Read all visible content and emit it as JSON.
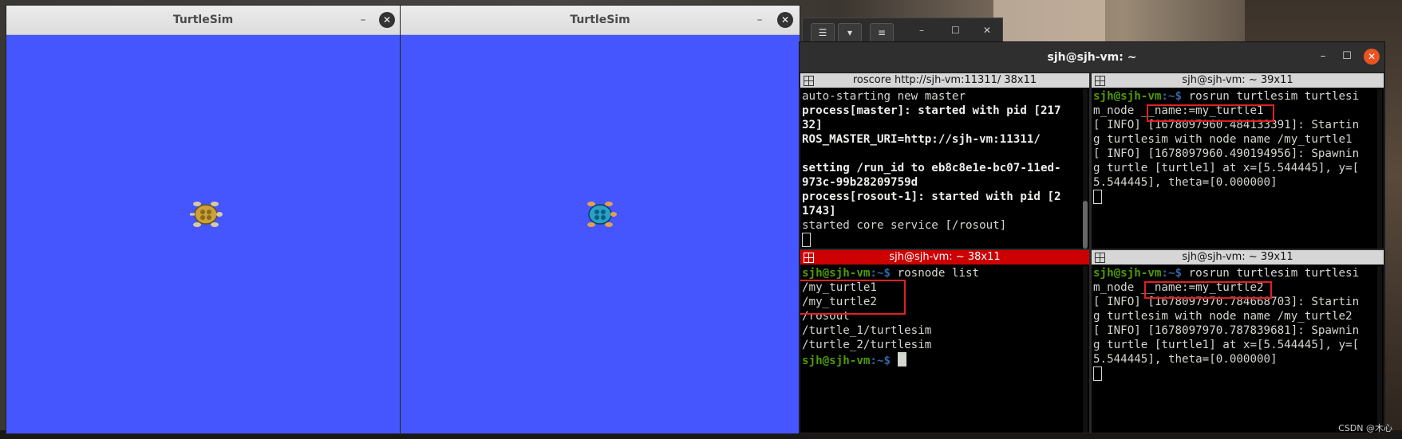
{
  "turtlesim1": {
    "title": "TurtleSim",
    "min": "–",
    "close": "✕"
  },
  "turtlesim2": {
    "title": "TurtleSim",
    "min": "–",
    "close": "✕"
  },
  "backwindow": {
    "btn1": "☰",
    "btn2": "▾",
    "btn3": "≡",
    "min": "–",
    "max": "☐",
    "close": "✕"
  },
  "terminal": {
    "title": "sjh@sjh-vm: ~",
    "min": "–",
    "max": "☐",
    "close": "✕",
    "panes": {
      "top_left": {
        "header": "roscore http://sjh-vm:11311/ 38x11",
        "lines": {
          "l1": "auto-starting new master",
          "l2a": "process[master]: started with pid [217",
          "l2b": "32]",
          "l3": "ROS_MASTER_URI=http://sjh-vm:11311/",
          "l4a": "setting /run_id to eb8c8e1e-bc07-11ed-",
          "l4b": "973c-99b28209759d",
          "l5a": "process[rosout-1]: started with pid [2",
          "l5b": "1743]",
          "l6": "started core service [/rosout]"
        }
      },
      "top_right": {
        "header": "sjh@sjh-vm: ~ 39x11",
        "prompt_user": "sjh@sjh-vm",
        "prompt_path": ":~$ ",
        "cmd1": "rosrun turtlesim turtlesi",
        "cmd2": "m_node __name:=my_turtle1",
        "l1": "[ INFO] [1678097960.484133391]: Startin",
        "l2": "g turtlesim with node name /my_turtle1",
        "l3": "[ INFO] [1678097960.490194956]: Spawnin",
        "l4": "g turtle [turtle1] at x=[5.544445], y=[",
        "l5": "5.544445], theta=[0.000000]"
      },
      "bottom_left": {
        "header": "sjh@sjh-vm: ~ 38x11",
        "prompt_user": "sjh@sjh-vm",
        "prompt_path": ":~$ ",
        "cmd": "rosnode list",
        "nodes": [
          "/my_turtle1",
          "/my_turtle2",
          "/rosout",
          "/turtle_1/turtlesim",
          "/turtle_2/turtlesim"
        ]
      },
      "bottom_right": {
        "header": "sjh@sjh-vm: ~ 39x11",
        "prompt_user": "sjh@sjh-vm",
        "prompt_path": ":~$ ",
        "cmd1": "rosrun turtlesim turtlesi",
        "cmd2": "m_node __name:=my_turtle2",
        "l1": "[ INFO] [1678097970.784668703]: Startin",
        "l2": "g turtlesim with node name /my_turtle2",
        "l3": "[ INFO] [1678097970.787839681]: Spawnin",
        "l4": "g turtle [turtle1] at x=[5.544445], y=[",
        "l5": "5.544445], theta=[0.000000]"
      }
    }
  },
  "watermark": "CSDN @木心",
  "colors": {
    "turtle_bg": "#4556ff",
    "active_pane": "#cc0000",
    "prompt": "#4e9a06",
    "close_orange": "#e95420"
  }
}
